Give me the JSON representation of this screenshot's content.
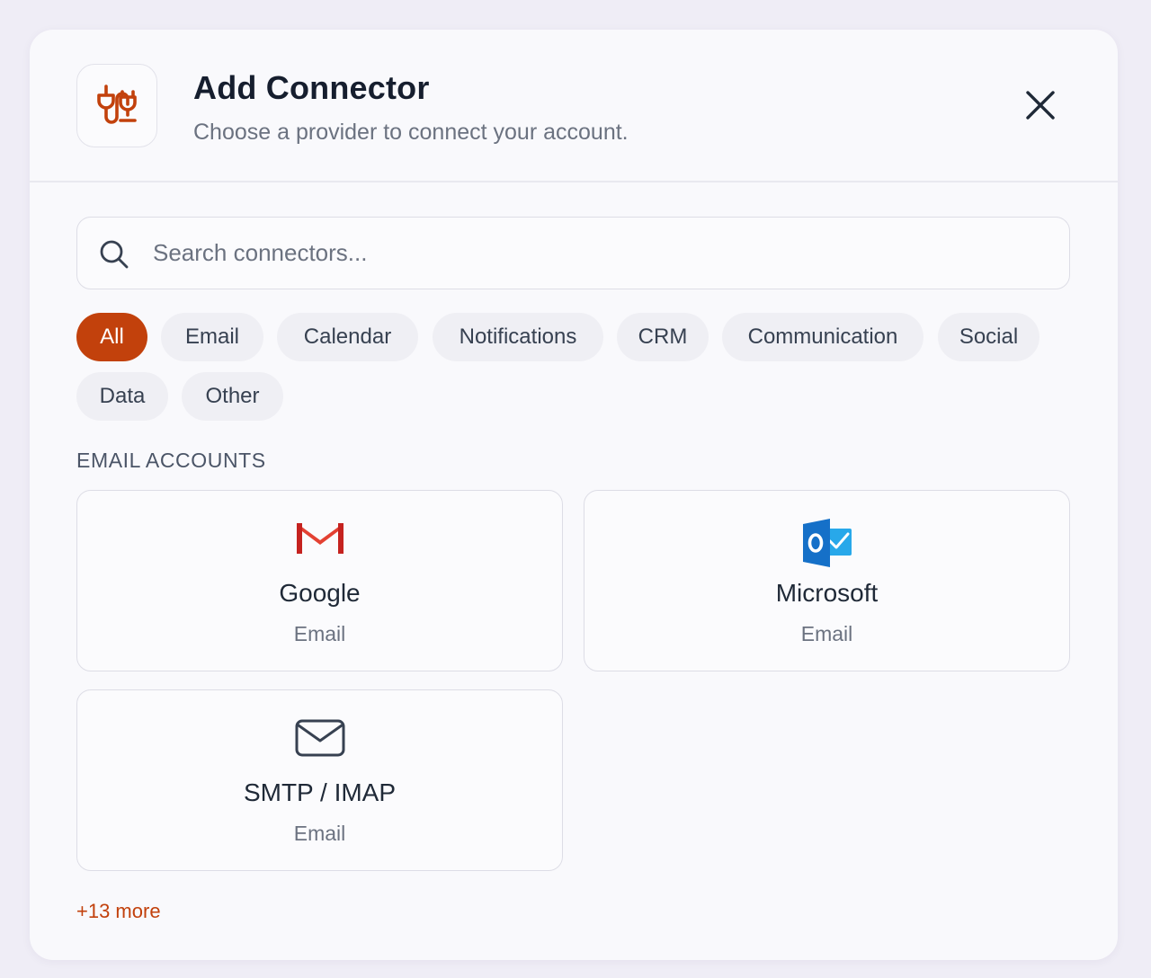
{
  "dialog": {
    "title": "Add Connector",
    "subtitle": "Choose a provider to connect your account.",
    "header_icon": "plug-icon",
    "close_icon": "close-icon"
  },
  "search": {
    "placeholder": "Search connectors...",
    "value": "",
    "icon": "search-icon"
  },
  "filters": {
    "selected": "All",
    "chips": [
      {
        "label": "All",
        "active": true
      },
      {
        "label": "Email",
        "active": false
      },
      {
        "label": "Calendar",
        "active": false
      },
      {
        "label": "Notifications",
        "active": false
      },
      {
        "label": "CRM",
        "active": false
      },
      {
        "label": "Communication",
        "active": false
      },
      {
        "label": "Social",
        "active": false
      },
      {
        "label": "Data",
        "active": false
      },
      {
        "label": "Other",
        "active": false
      }
    ]
  },
  "section": {
    "label": "EMAIL ACCOUNTS",
    "cards": [
      {
        "name": "Google",
        "type": "Email",
        "icon": "gmail-icon"
      },
      {
        "name": "Microsoft",
        "type": "Email",
        "icon": "outlook-icon"
      },
      {
        "name": "SMTP / IMAP",
        "type": "Email",
        "icon": "envelope-icon"
      }
    ]
  },
  "more_link": "+13 more",
  "colors": {
    "accent": "#c2410c",
    "background": "#efedf6",
    "dialog": "#f9f9fc",
    "gmail_red": "#e34133",
    "outlook_blue": "#1570c8"
  }
}
